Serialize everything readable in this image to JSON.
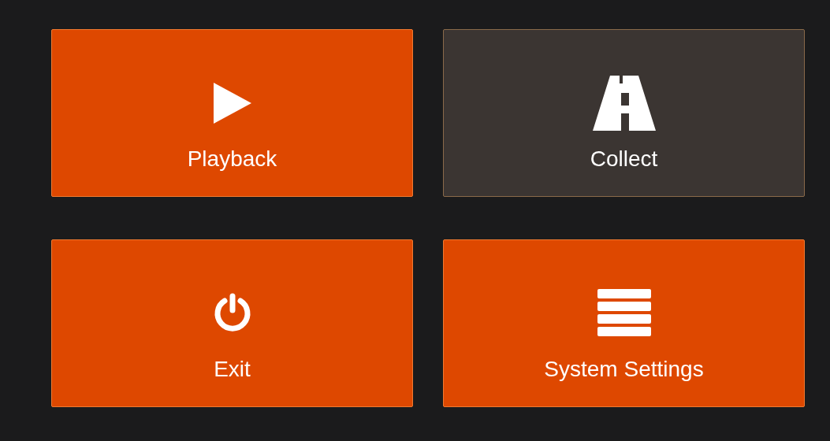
{
  "tiles": [
    {
      "label": "Playback",
      "kind": "play",
      "selected": false
    },
    {
      "label": "Collect",
      "kind": "road",
      "selected": true
    },
    {
      "label": "Exit",
      "kind": "power",
      "selected": false
    },
    {
      "label": "System Settings",
      "kind": "menu",
      "selected": false
    }
  ]
}
